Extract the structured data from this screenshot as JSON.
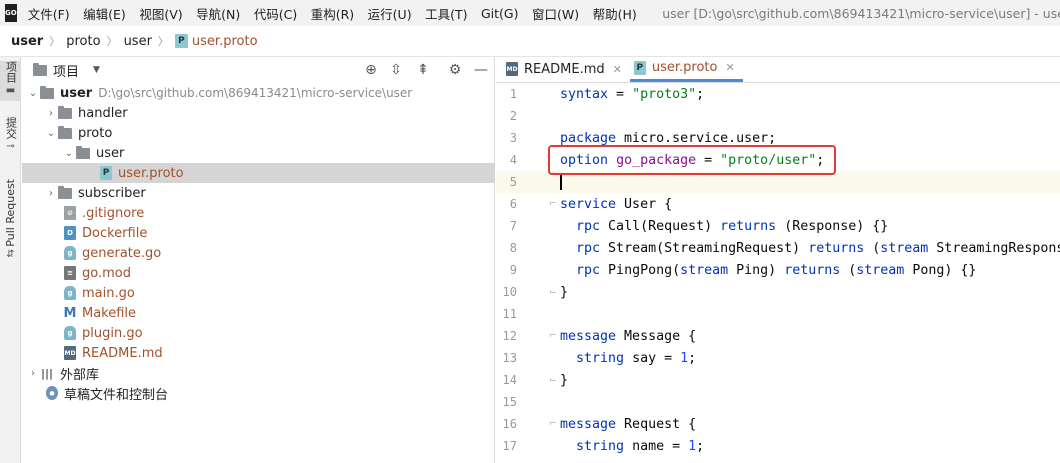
{
  "app": {
    "logo": "GO",
    "window_title": "user [D:\\go\\src\\github.com\\869413421\\micro-service\\user] - user.proto"
  },
  "menu": [
    "文件(F)",
    "编辑(E)",
    "视图(V)",
    "导航(N)",
    "代码(C)",
    "重构(R)",
    "运行(U)",
    "工具(T)",
    "Git(G)",
    "窗口(W)",
    "帮助(H)"
  ],
  "breadcrumb": {
    "items": [
      "user",
      "proto",
      "user"
    ],
    "file_icon": "P",
    "file": "user.proto"
  },
  "toolstrip": {
    "project": "项目",
    "commit": "提交",
    "pull_request": "Pull Request"
  },
  "project_panel": {
    "title": "项目",
    "tree": [
      {
        "label": "user",
        "path": "D:\\go\\src\\github.com\\869413421\\micro-service\\user",
        "type": "folder",
        "expanded": true
      },
      {
        "label": "handler",
        "type": "folder",
        "expanded": false
      },
      {
        "label": "proto",
        "type": "folder",
        "expanded": true
      },
      {
        "label": "user",
        "type": "folder",
        "expanded": true
      },
      {
        "label": "user.proto",
        "type": "proto"
      },
      {
        "label": "subscriber",
        "type": "folder",
        "expanded": false
      },
      {
        "label": ".gitignore",
        "type": "git"
      },
      {
        "label": "Dockerfile",
        "type": "docker"
      },
      {
        "label": "generate.go",
        "type": "go"
      },
      {
        "label": "go.mod",
        "type": "mod"
      },
      {
        "label": "main.go",
        "type": "go"
      },
      {
        "label": "Makefile",
        "type": "make"
      },
      {
        "label": "plugin.go",
        "type": "go"
      },
      {
        "label": "README.md",
        "type": "md"
      },
      {
        "label": "外部库",
        "type": "lib"
      },
      {
        "label": "草稿文件和控制台",
        "type": "scratch"
      }
    ]
  },
  "editor": {
    "tabs": [
      {
        "label": "README.md",
        "icon": "MD",
        "active": false
      },
      {
        "label": "user.proto",
        "icon": "P",
        "active": true
      }
    ],
    "lines": [
      {
        "n": "1",
        "text": "syntax = \"proto3\";"
      },
      {
        "n": "2",
        "text": ""
      },
      {
        "n": "3",
        "text": "package micro.service.user;"
      },
      {
        "n": "4",
        "text": "option go_package = \"proto/user\";"
      },
      {
        "n": "5",
        "text": ""
      },
      {
        "n": "6",
        "text": "service User {"
      },
      {
        "n": "7",
        "text": "  rpc Call(Request) returns (Response) {}"
      },
      {
        "n": "8",
        "text": "  rpc Stream(StreamingRequest) returns (stream StreamingResponse) {}"
      },
      {
        "n": "9",
        "text": "  rpc PingPong(stream Ping) returns (stream Pong) {}"
      },
      {
        "n": "10",
        "text": "}"
      },
      {
        "n": "11",
        "text": ""
      },
      {
        "n": "12",
        "text": "message Message {"
      },
      {
        "n": "13",
        "text": "  string say = 1;"
      },
      {
        "n": "14",
        "text": "}"
      },
      {
        "n": "15",
        "text": ""
      },
      {
        "n": "16",
        "text": "message Request {"
      },
      {
        "n": "17",
        "text": "  string name = 1;"
      }
    ],
    "current_line": "5",
    "highlight_line": "4"
  },
  "colors": {
    "keyword": "#0033b3",
    "string": "#067d17",
    "number": "#1750eb",
    "highlight_box": "#e53935",
    "active_file": "#a0522d"
  }
}
